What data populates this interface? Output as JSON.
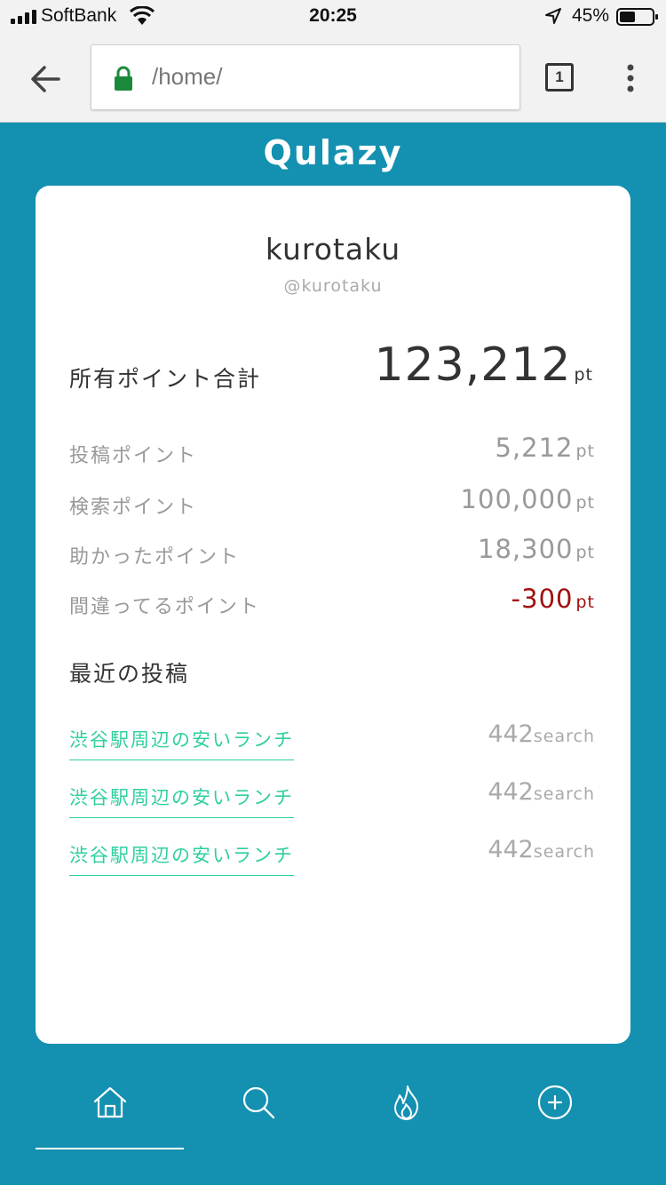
{
  "status_bar": {
    "carrier": "SoftBank",
    "time": "20:25",
    "battery": "45%"
  },
  "browser": {
    "url": "/home/",
    "tab_count": "1"
  },
  "app": {
    "brand": "Qulazy"
  },
  "profile": {
    "name": "kurotaku",
    "handle": "@kurotaku"
  },
  "points": {
    "total_label": "所有ポイント合計",
    "total_value": "123,212",
    "unit": "pt",
    "breakdown": [
      {
        "label": "投稿ポイント",
        "value": "5,212",
        "unit": "pt"
      },
      {
        "label": "検索ポイント",
        "value": "100,000",
        "unit": "pt"
      },
      {
        "label": "助かったポイント",
        "value": "18,300",
        "unit": "pt"
      },
      {
        "label": "間違ってるポイント",
        "value": "-300",
        "unit": "pt"
      }
    ]
  },
  "recent_posts": {
    "title": "最近の投稿",
    "items": [
      {
        "title": "渋谷駅周辺の安いランチ",
        "count": "442",
        "unit": "search"
      },
      {
        "title": "渋谷駅周辺の安いランチ",
        "count": "442",
        "unit": "search"
      },
      {
        "title": "渋谷駅周辺の安いランチ",
        "count": "442",
        "unit": "search"
      }
    ]
  },
  "nav": {
    "items": [
      {
        "icon": "home-icon",
        "active": true
      },
      {
        "icon": "search-icon",
        "active": false
      },
      {
        "icon": "fire-icon",
        "active": false
      },
      {
        "icon": "plus-circle-icon",
        "active": false
      }
    ]
  },
  "colors": {
    "background": "#1490b1",
    "accent": "#2ecfa0",
    "negative": "#a01010"
  }
}
